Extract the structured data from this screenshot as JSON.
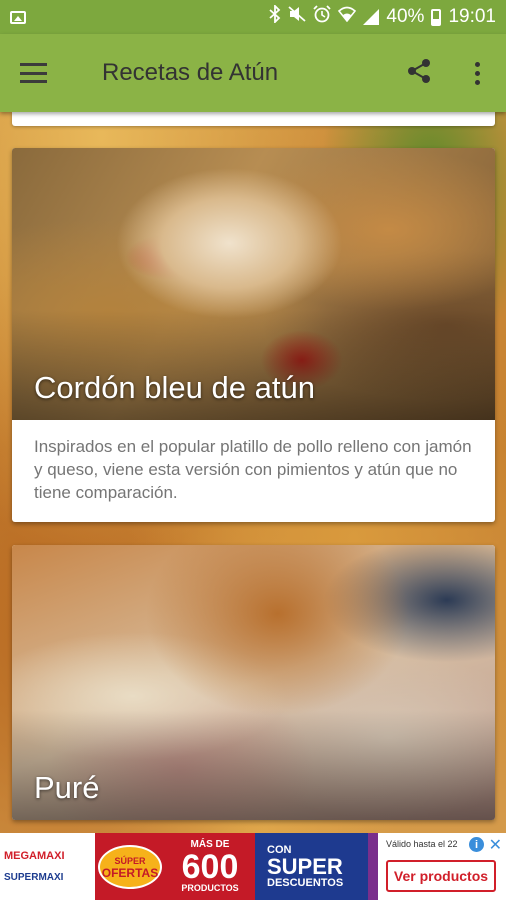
{
  "status_bar": {
    "battery_text": "40%",
    "time": "19:01",
    "icons": [
      "image-notification-icon",
      "bluetooth-icon",
      "mute-icon",
      "alarm-icon",
      "wifi-icon",
      "signal-icon",
      "battery-icon"
    ]
  },
  "app_bar": {
    "title": "Recetas de Atún",
    "color": "#8bb346",
    "status_color": "#7da83e"
  },
  "recipes": [
    {
      "title": "Cordón bleu de atún",
      "description": "Inspirados en el popular platillo de pollo relleno con jamón y queso, viene esta versión con pimientos y atún que no tiene comparación."
    },
    {
      "title": "Puré",
      "description": ""
    }
  ],
  "ad": {
    "brand_top": "MEGAMAXI",
    "brand_bottom": "SUPERMAXI",
    "badge_top": "SÚPER",
    "badge_main": "OFERTAS",
    "mas_de": "MÁS DE",
    "count": "600",
    "productos": "PRODUCTOS",
    "con": "CON",
    "super": "SUPER",
    "descuentos": "DESCUENTOS",
    "valid": "Válido hasta el 22",
    "cta": "Ver productos",
    "info": "i",
    "close": "✕"
  }
}
